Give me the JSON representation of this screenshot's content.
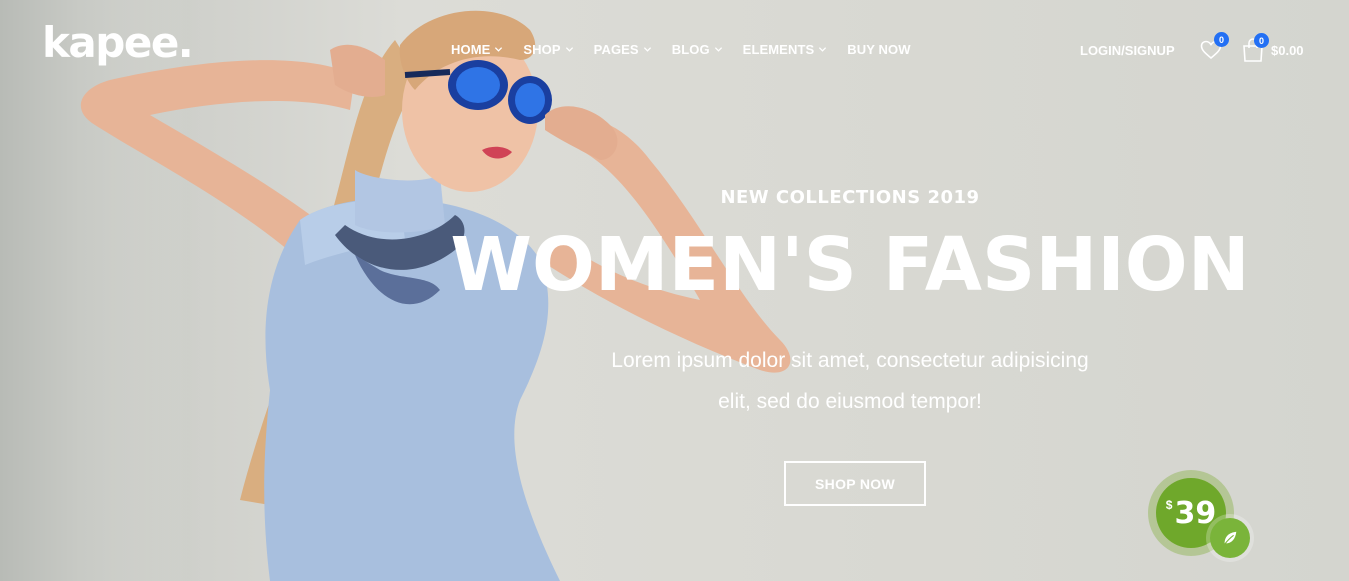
{
  "brand": {
    "logo_text": "kapee."
  },
  "nav": {
    "items": [
      {
        "label": "HOME",
        "has_dropdown": true
      },
      {
        "label": "SHOP",
        "has_dropdown": true
      },
      {
        "label": "PAGES",
        "has_dropdown": true
      },
      {
        "label": "BLOG",
        "has_dropdown": true
      },
      {
        "label": "ELEMENTS",
        "has_dropdown": true
      },
      {
        "label": "BUY NOW",
        "has_dropdown": false
      }
    ]
  },
  "header_right": {
    "login_label": "LOGIN/SIGNUP",
    "wishlist_count": "0",
    "cart_count": "0",
    "cart_total": "$0.00",
    "icons": [
      "heart-icon",
      "shopping-bag-icon"
    ]
  },
  "hero": {
    "subtitle": "NEW COLLECTIONS 2019",
    "title": "WOMEN'S FASHION",
    "description_line1": "Lorem ipsum dolor sit amet, consectetur adipisicing",
    "description_line2": "elit, sed do eiusmod tempor!",
    "cta_label": "SHOP NOW"
  },
  "price_badge": {
    "currency": "$",
    "amount": "39",
    "icon": "leaf-icon"
  },
  "colors": {
    "badge_blue": "#2370f4",
    "price_green": "#6fa82b",
    "leaf_green": "#7ab43a",
    "text_white": "#ffffff"
  }
}
